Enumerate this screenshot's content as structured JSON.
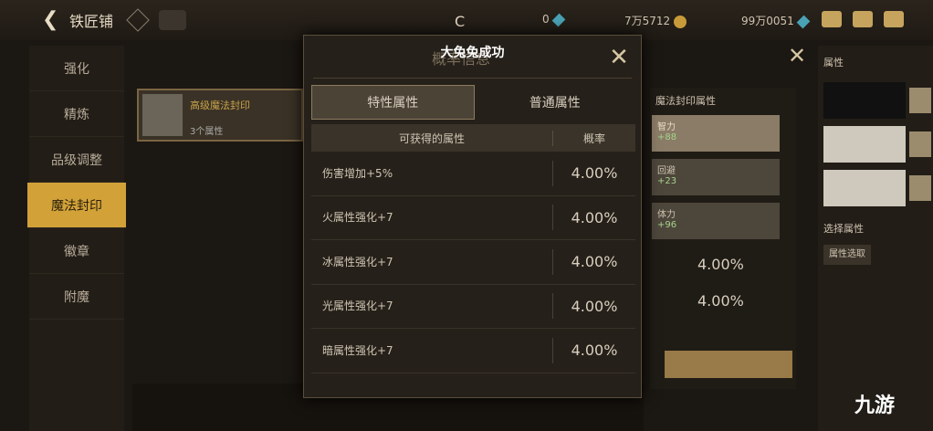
{
  "topbar": {
    "title": "铁匠铺",
    "res1": "0",
    "res2": "7万5712",
    "res3": "99万0051"
  },
  "sidebar": {
    "items": [
      {
        "label": "强化"
      },
      {
        "label": "精炼"
      },
      {
        "label": "品级调整"
      },
      {
        "label": "魔法封印"
      },
      {
        "label": "徽章"
      },
      {
        "label": "附魔"
      }
    ]
  },
  "left_card": {
    "name": "高级魔法封印",
    "sub": "3个属性"
  },
  "modal": {
    "title": "大兔兔成功",
    "ghost_title": "概率信息",
    "tabs": [
      {
        "label": "特性属性"
      },
      {
        "label": "普通属性"
      }
    ],
    "table": {
      "col_attr": "可获得的属性",
      "col_prob": "概率",
      "rows": [
        {
          "attr": "伤害增加+5%",
          "prob": "4.00%"
        },
        {
          "attr": "火属性强化+7",
          "prob": "4.00%"
        },
        {
          "attr": "冰属性强化+7",
          "prob": "4.00%"
        },
        {
          "attr": "光属性强化+7",
          "prob": "4.00%"
        },
        {
          "attr": "暗属性强化+7",
          "prob": "4.00%"
        }
      ]
    }
  },
  "right_panel": {
    "title": "魔法封印属性",
    "cards": [
      {
        "name": "智力",
        "val": "+88"
      },
      {
        "name": "回避",
        "val": "+23"
      },
      {
        "name": "体力",
        "val": "+96"
      }
    ],
    "values": [
      "4.00%",
      "4.00%"
    ]
  },
  "far_right": {
    "title": "属性",
    "label": "选择属性",
    "btn": "属性选取"
  },
  "watermark": "九游"
}
